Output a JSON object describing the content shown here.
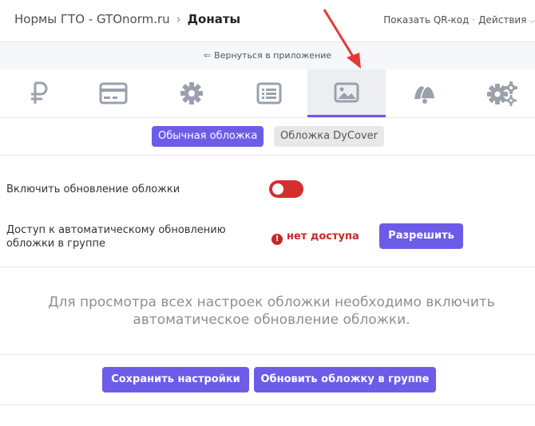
{
  "header": {
    "app_name": "Нормы ГТО - GTOnorm.ru",
    "separator": "›",
    "page_title": "Донаты",
    "qr_link": "Показать QR-код",
    "dot": "·",
    "actions": "Действия"
  },
  "back": {
    "arrow": "⇐",
    "label": "Вернуться в приложение"
  },
  "tabs": [
    {
      "icon": "ruble-icon"
    },
    {
      "icon": "card-icon"
    },
    {
      "icon": "gear-icon"
    },
    {
      "icon": "list-icon"
    },
    {
      "icon": "image-icon",
      "active": true
    },
    {
      "icon": "bells-icon"
    },
    {
      "icon": "gears-icon"
    }
  ],
  "subtabs": {
    "regular": "Обычная обложка",
    "dycover": "Обложка DyCover"
  },
  "settings": {
    "toggle_label": "Включить обновление обложки",
    "toggle_on": false,
    "access_label_line1": "Доступ к автоматическому обновлению",
    "access_label_line2": "обложки в группе",
    "access_status": "нет доступа",
    "access_status_icon": "!",
    "allow_button": "Разрешить"
  },
  "notice": {
    "line1": "Для просмотра всех настроек обложки необходимо включить",
    "line2": "автоматическое обновление обложки."
  },
  "actions": {
    "save": "Сохранить настройки",
    "update_cover": "Обновить обложку в группе"
  },
  "colors": {
    "accent": "#6c5ce7",
    "danger": "#d32f2f",
    "annotation": "#e53935"
  }
}
